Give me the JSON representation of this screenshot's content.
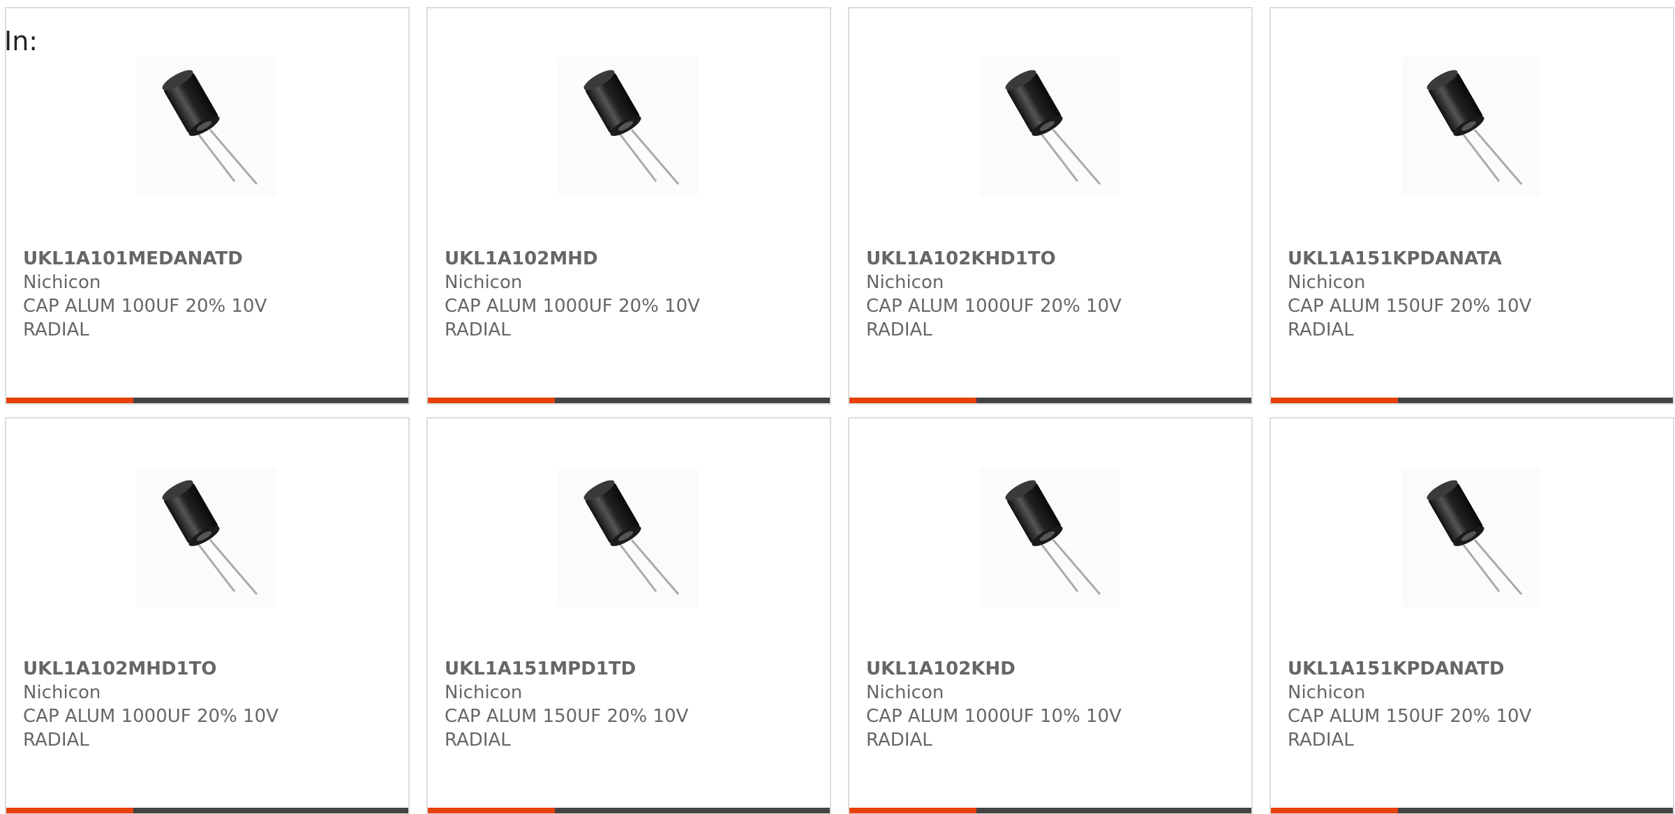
{
  "header": {
    "label": "In:"
  },
  "colors": {
    "accent": "#e8400c",
    "bar": "#444444",
    "text": "#666666",
    "border": "#dcdcdc"
  },
  "products": [
    {
      "part": "UKL1A101MEDANATD",
      "manufacturer": "Nichicon",
      "description": "CAP ALUM 100UF 20% 10V RADIAL",
      "icon": "capacitor-image"
    },
    {
      "part": "UKL1A102MHD",
      "manufacturer": "Nichicon",
      "description": "CAP ALUM 1000UF 20% 10V RADIAL",
      "icon": "capacitor-image"
    },
    {
      "part": "UKL1A102KHD1TO",
      "manufacturer": "Nichicon",
      "description": "CAP ALUM 1000UF 20% 10V RADIAL",
      "icon": "capacitor-image"
    },
    {
      "part": "UKL1A151KPDANATA",
      "manufacturer": "Nichicon",
      "description": "CAP ALUM 150UF 20% 10V RADIAL",
      "icon": "capacitor-image"
    },
    {
      "part": "UKL1A102MHD1TO",
      "manufacturer": "Nichicon",
      "description": "CAP ALUM 1000UF 20% 10V RADIAL",
      "icon": "capacitor-image"
    },
    {
      "part": "UKL1A151MPD1TD",
      "manufacturer": "Nichicon",
      "description": "CAP ALUM 150UF 20% 10V RADIAL",
      "icon": "capacitor-image"
    },
    {
      "part": "UKL1A102KHD",
      "manufacturer": "Nichicon",
      "description": "CAP ALUM 1000UF 10% 10V RADIAL",
      "icon": "capacitor-image"
    },
    {
      "part": "UKL1A151KPDANATD",
      "manufacturer": "Nichicon",
      "description": "CAP ALUM 150UF 20% 10V RADIAL",
      "icon": "capacitor-image"
    }
  ]
}
